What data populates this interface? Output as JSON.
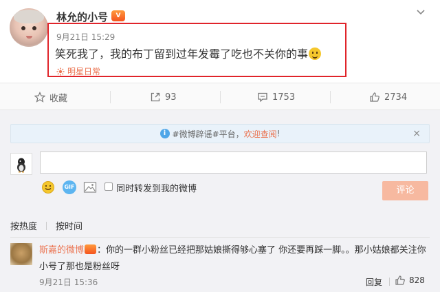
{
  "post": {
    "username": "林允的小号",
    "badge": "vip",
    "time": "9月21日 15:29",
    "text": "笑死我了，我的布丁留到过年发霉了吃也不关你的事",
    "source": "明星日常"
  },
  "actions": {
    "favorite": "收藏",
    "repost_count": "93",
    "comment_count": "1753",
    "like_count": "2734"
  },
  "notice": {
    "text_before": "#微博辟谣#平台，",
    "link_text": "欢迎查阅",
    "text_after": "!",
    "close": "×"
  },
  "composer": {
    "input_value": "",
    "share_label": "同时转发到我的微博",
    "submit_label": "评论",
    "gif_label": "GIF"
  },
  "sort": {
    "by_hot": "按热度",
    "by_time": "按时间"
  },
  "comment": {
    "name": "斯嘉的微博",
    "badge": "vip",
    "text": "：你的一群小粉丝已经把那姑娘撕得够心塞了 你还要再踩一脚。。那小姑娘都关注你小号了那也是粉丝呀",
    "time": "9月21日 15:36",
    "reply": "回复",
    "likes": "828"
  },
  "colors": {
    "accent_orange": "#eb7350",
    "highlight_red": "#e0242a",
    "submit_disabled": "#f7b9a0"
  }
}
